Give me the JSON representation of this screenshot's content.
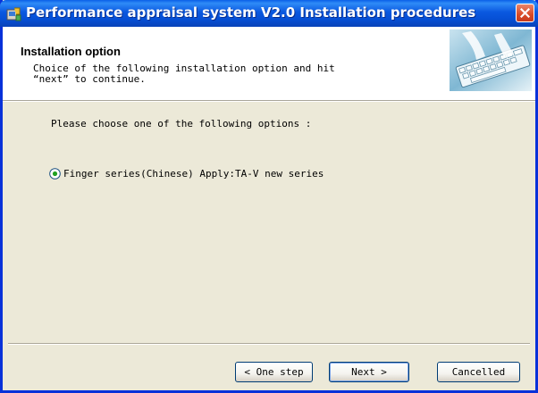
{
  "window": {
    "title": "Performance appraisal system V2.0 Installation procedures"
  },
  "header": {
    "title": "Installation option",
    "description": "Choice of the following installation option and hit\n“next” to continue."
  },
  "main": {
    "prompt": "Please choose one of the following options :",
    "options": [
      {
        "label": "Finger series(Chinese) Apply:TA-V new series",
        "selected": true
      }
    ]
  },
  "buttons": {
    "back": "< One step",
    "next": "Next >",
    "cancel": "Cancelled"
  },
  "colors": {
    "titlebar": "#0a58e0",
    "close": "#d94a26",
    "background": "#ece9d8",
    "radio_dot": "#21a121"
  },
  "icons": {
    "title_icon": "installer-icon",
    "header_image": "keyboard-hands-image",
    "close": "close-icon"
  }
}
